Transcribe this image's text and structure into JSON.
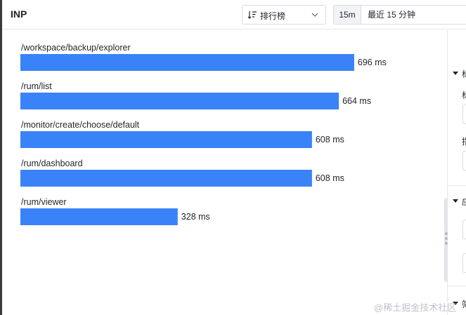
{
  "header": {
    "title": "INP",
    "sort_label": "排行榜",
    "time_short": "15m",
    "time_range": "最近 15 分钟"
  },
  "chart_data": {
    "type": "bar",
    "orientation": "horizontal",
    "categories": [
      "/workspace/backup/explorer",
      "/rum/list",
      "/monitor/create/choose/default",
      "/rum/dashboard",
      "/rum/viewer"
    ],
    "values": [
      696,
      664,
      608,
      608,
      328
    ],
    "value_labels": [
      "696 ms",
      "664 ms",
      "608 ms",
      "608 ms",
      "328 ms"
    ],
    "unit": "ms",
    "xlim": [
      0,
      850
    ],
    "bar_color": "#3a82f7",
    "grid": false
  },
  "right_panel": {
    "glyphs": [
      "标",
      "标",
      "指",
      "应",
      "筛"
    ]
  },
  "watermark": "@稀土掘金技术社区"
}
